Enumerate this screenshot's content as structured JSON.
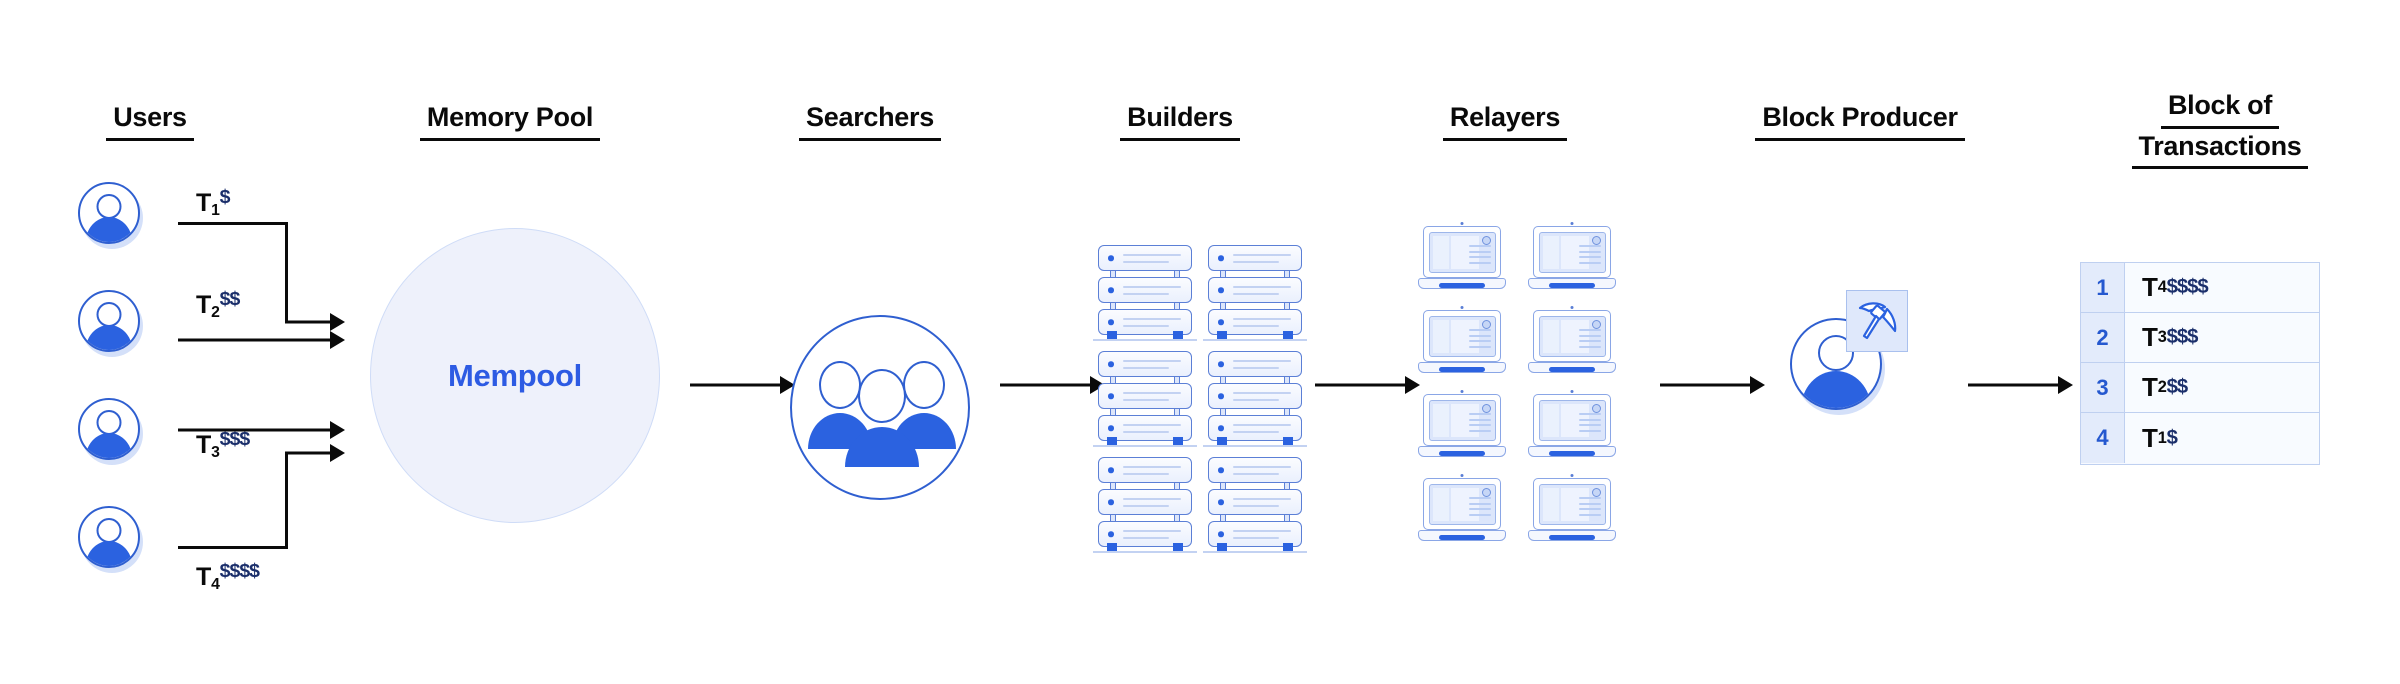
{
  "columns": [
    {
      "id": "users",
      "title": "Users"
    },
    {
      "id": "memory_pool",
      "title": "Memory Pool"
    },
    {
      "id": "searchers",
      "title": "Searchers"
    },
    {
      "id": "builders",
      "title": "Builders"
    },
    {
      "id": "relayers",
      "title": "Relayers"
    },
    {
      "id": "block_producer",
      "title": "Block Producer"
    },
    {
      "id": "block_of_transactions",
      "title_line1": "Block of",
      "title_line2": "Transactions"
    }
  ],
  "users": {
    "transactions": [
      {
        "name": "T",
        "index": "1",
        "fee": "$"
      },
      {
        "name": "T",
        "index": "2",
        "fee": "$$"
      },
      {
        "name": "T",
        "index": "3",
        "fee": "$$$"
      },
      {
        "name": "T",
        "index": "4",
        "fee": "$$$$"
      }
    ],
    "icon": "user-avatar-icon",
    "count": 4
  },
  "memory_pool": {
    "label": "Mempool",
    "shape": "circle"
  },
  "searchers": {
    "icon": "three-people-icon",
    "people_count": 3
  },
  "builders": {
    "icon": "server-rack-icon",
    "rack_count": 6,
    "units_per_rack": 3,
    "grid": {
      "columns": 2,
      "rows": 3
    }
  },
  "relayers": {
    "icon": "laptop-icon",
    "laptop_count": 8,
    "grid": {
      "columns": 2,
      "rows": 4
    }
  },
  "block_producer": {
    "icon": "miner-avatar-icon",
    "badge_icon": "pickaxe-icon"
  },
  "block_of_transactions": {
    "rows": [
      {
        "position": "1",
        "name": "T",
        "index": "4",
        "fee": "$$$$"
      },
      {
        "position": "2",
        "name": "T",
        "index": "3",
        "fee": "$$$"
      },
      {
        "position": "3",
        "name": "T",
        "index": "2",
        "fee": "$$"
      },
      {
        "position": "4",
        "name": "T",
        "index": "1",
        "fee": "$"
      }
    ]
  },
  "colors": {
    "primary_blue": "#2b62e0",
    "outline_blue": "#2f5fd0",
    "mempool_text": "#2d5be3",
    "mempool_fill": "#eef1fb",
    "table_index_fill": "#e3ebfb",
    "table_border": "#bfd0f0",
    "fee_superscript": "#1b2f6b",
    "arrow": "#0a0a0a",
    "background": "#ffffff"
  }
}
